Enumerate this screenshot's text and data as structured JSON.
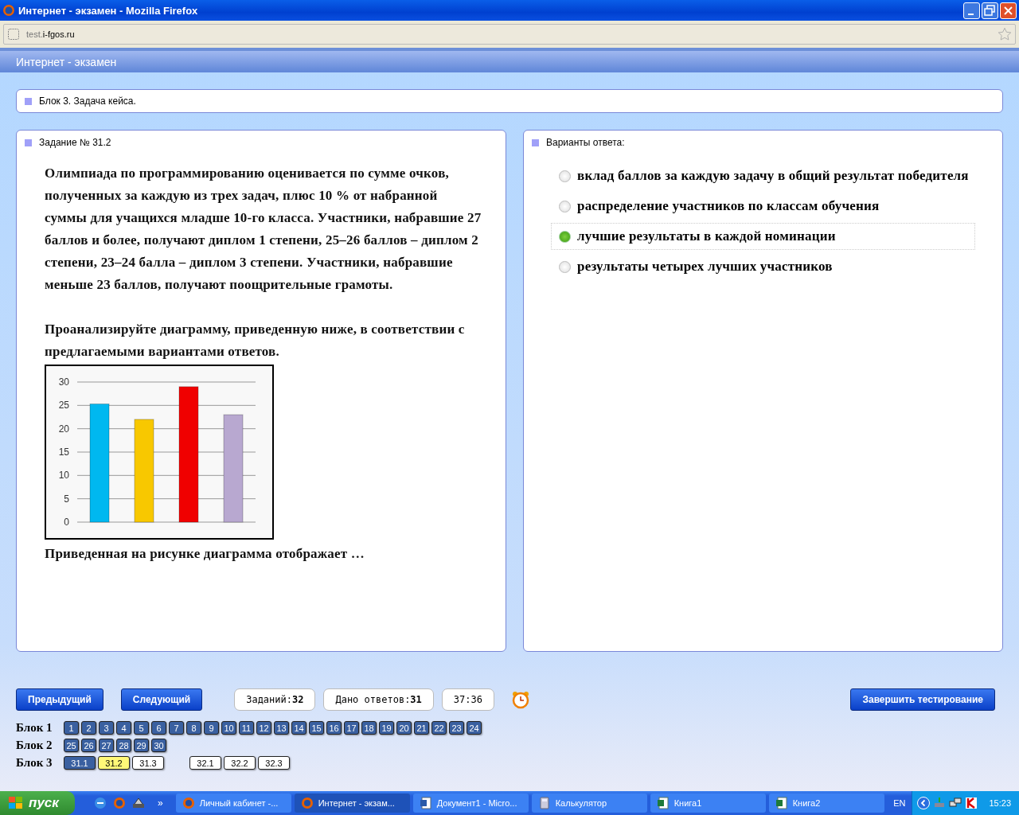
{
  "window": {
    "title": "Интернет - экзамен - Mozilla Firefox"
  },
  "address_bar": {
    "prefix": "test.",
    "domain": "i-fgos.ru"
  },
  "header": {
    "title": "Интернет - экзамен"
  },
  "block_title": "Блок 3. Задача кейса.",
  "task": {
    "heading": "Задание № 31.2",
    "paragraphs": [
      "Олимпиада по программированию оценивается по сумме очков, полученных за каждую из трех задач, плюс 10 % от набранной суммы для учащихся младше 10-го класса. Участники, набравшие 27 баллов и более, получают диплом 1 степени, 25–26 баллов – диплом 2 степени, 23–24 балла – диплом 3 степени. Участники, набравшие меньше 23 баллов, получают поощрительные грамоты.",
      "Проанализируйте диаграмму, приведенную ниже, в соответствии с предлагаемыми вариантами ответов."
    ],
    "chart_data": {
      "type": "bar",
      "grid": true,
      "values": [
        25.3,
        22,
        29,
        23
      ],
      "colors": [
        "#00b8f0",
        "#f8c800",
        "#f00000",
        "#b8a8d0"
      ],
      "ylim": [
        0,
        30
      ],
      "yticks": [
        0,
        5,
        10,
        15,
        20,
        25,
        30
      ]
    },
    "question": "Приведенная на рисунке диаграмма отображает …"
  },
  "answers": {
    "heading": "Варианты ответа:",
    "options": [
      {
        "label": "вклад баллов за каждую задачу в общий результат победителя",
        "selected": false
      },
      {
        "label": "распределение участников по классам обучения",
        "selected": false
      },
      {
        "label": "лучшие результаты в каждой номинации",
        "selected": true
      },
      {
        "label": "результаты четырех лучших участников",
        "selected": false
      }
    ]
  },
  "nav": {
    "prev": "Предыдущий",
    "next": "Следующий",
    "tasks_label": "Заданий:",
    "tasks_count": "32",
    "answered_label": "Дано ответов:",
    "answered_count": "31",
    "timer": "37:36",
    "finish": "Завершить тестирование"
  },
  "blocks": [
    {
      "label": "Блок 1",
      "groups": [
        [
          {
            "n": "1",
            "answered": true,
            "selected": false
          },
          {
            "n": "2",
            "answered": true,
            "selected": false
          },
          {
            "n": "3",
            "answered": true,
            "selected": false
          },
          {
            "n": "4",
            "answered": true,
            "selected": false
          },
          {
            "n": "5",
            "answered": true,
            "selected": false
          },
          {
            "n": "6",
            "answered": true,
            "selected": false
          },
          {
            "n": "7",
            "answered": true,
            "selected": false
          },
          {
            "n": "8",
            "answered": true,
            "selected": false
          },
          {
            "n": "9",
            "answered": true,
            "selected": false
          },
          {
            "n": "10",
            "answered": true,
            "selected": false
          },
          {
            "n": "11",
            "answered": true,
            "selected": false
          },
          {
            "n": "12",
            "answered": true,
            "selected": false
          },
          {
            "n": "13",
            "answered": true,
            "selected": false
          },
          {
            "n": "14",
            "answered": true,
            "selected": false
          },
          {
            "n": "15",
            "answered": true,
            "selected": false
          },
          {
            "n": "16",
            "answered": true,
            "selected": false
          },
          {
            "n": "17",
            "answered": true,
            "selected": false
          },
          {
            "n": "18",
            "answered": true,
            "selected": false
          },
          {
            "n": "19",
            "answered": true,
            "selected": false
          },
          {
            "n": "20",
            "answered": true,
            "selected": false
          },
          {
            "n": "21",
            "answered": true,
            "selected": false
          },
          {
            "n": "22",
            "answered": true,
            "selected": false
          },
          {
            "n": "23",
            "answered": true,
            "selected": false
          },
          {
            "n": "24",
            "answered": true,
            "selected": false
          }
        ]
      ]
    },
    {
      "label": "Блок 2",
      "groups": [
        [
          {
            "n": "25",
            "answered": true,
            "selected": false
          },
          {
            "n": "26",
            "answered": true,
            "selected": false
          },
          {
            "n": "27",
            "answered": true,
            "selected": false
          },
          {
            "n": "28",
            "answered": true,
            "selected": false
          },
          {
            "n": "29",
            "answered": true,
            "selected": false
          },
          {
            "n": "30",
            "answered": true,
            "selected": false
          }
        ]
      ]
    },
    {
      "label": "Блок 3",
      "groups": [
        [
          {
            "n": "31.1",
            "answered": true,
            "selected": false
          },
          {
            "n": "31.2",
            "answered": false,
            "selected": true
          },
          {
            "n": "31.3",
            "answered": false,
            "selected": false
          }
        ],
        [
          {
            "n": "32.1",
            "answered": false,
            "selected": false
          },
          {
            "n": "32.2",
            "answered": false,
            "selected": false
          },
          {
            "n": "32.3",
            "answered": false,
            "selected": false
          }
        ]
      ]
    }
  ],
  "taskbar": {
    "start": "пуск",
    "more": "»",
    "tasks": [
      {
        "label": "Личный кабинет -...",
        "kind": "browser",
        "selected": false
      },
      {
        "label": "Интернет - экзам...",
        "kind": "browser",
        "selected": true
      },
      {
        "label": "Документ1 - Micro...",
        "kind": "document",
        "selected": false
      },
      {
        "label": "Калькулятор",
        "kind": "calculator",
        "selected": false
      },
      {
        "label": "Книга1",
        "kind": "spreadsheet",
        "selected": false
      },
      {
        "label": "Книга2",
        "kind": "spreadsheet",
        "selected": false
      }
    ],
    "language": "EN",
    "clock": "15:23"
  }
}
